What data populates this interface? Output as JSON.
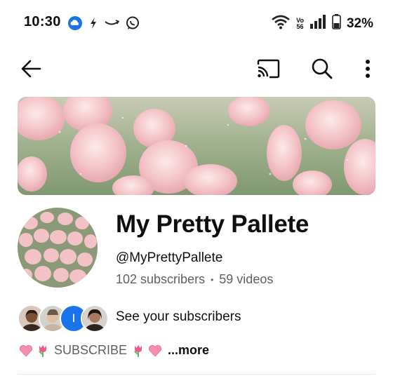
{
  "status_bar": {
    "time": "10:30",
    "left_icons": [
      "cloud-icon",
      "bolt-icon",
      "amazon-smile-icon",
      "whatsapp-icon"
    ],
    "right_icons": [
      "wifi-icon",
      "volte-icon",
      "signal-icon",
      "battery-icon"
    ],
    "volte_top": "Vo",
    "volte_bottom": "56",
    "battery": "32%"
  },
  "app_bar": {
    "icons": [
      "back-arrow-icon",
      "cast-icon",
      "search-icon",
      "more-vert-icon"
    ]
  },
  "channel": {
    "name": "My Pretty Pallete",
    "handle": "@MyPrettyPallete",
    "subscribers": "102 subscribers",
    "separator": "•",
    "videos": "59 videos",
    "see_subscribers": "See your subscribers",
    "subscriber_initial": "I",
    "description": "SUBSCRIBE",
    "more": "...more"
  },
  "colors": {
    "accent_blue": "#1a73e8",
    "text_primary": "#0f0f0f",
    "text_secondary": "#606060",
    "tulip_pink": "#f4c4c8",
    "grass_green": "#8fa77a"
  }
}
